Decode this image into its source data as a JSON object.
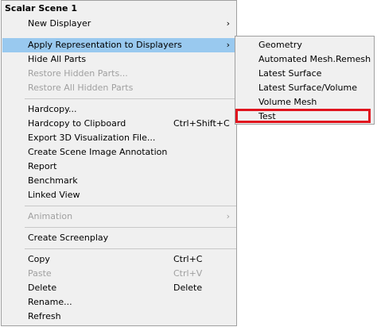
{
  "menu": {
    "title": "Scalar Scene 1",
    "items": [
      {
        "label": "New Displayer",
        "shortcut": "",
        "chevron": "›"
      },
      {
        "label": "Apply Representation to Displayers",
        "shortcut": "",
        "chevron": "›"
      },
      {
        "label": "Hide All Parts",
        "shortcut": "",
        "chevron": ""
      },
      {
        "label": "Restore Hidden Parts...",
        "shortcut": "",
        "chevron": ""
      },
      {
        "label": "Restore All Hidden Parts",
        "shortcut": "",
        "chevron": ""
      },
      {
        "label": "Hardcopy...",
        "shortcut": "",
        "chevron": ""
      },
      {
        "label": "Hardcopy to Clipboard",
        "shortcut": "Ctrl+Shift+C",
        "chevron": ""
      },
      {
        "label": "Export 3D Visualization File...",
        "shortcut": "",
        "chevron": ""
      },
      {
        "label": "Create Scene Image Annotation",
        "shortcut": "",
        "chevron": ""
      },
      {
        "label": "Report",
        "shortcut": "",
        "chevron": ""
      },
      {
        "label": "Benchmark",
        "shortcut": "",
        "chevron": ""
      },
      {
        "label": "Linked View",
        "shortcut": "",
        "chevron": ""
      },
      {
        "label": "Animation",
        "shortcut": "",
        "chevron": "›"
      },
      {
        "label": "Create Screenplay",
        "shortcut": "",
        "chevron": ""
      },
      {
        "label": "Copy",
        "shortcut": "Ctrl+C",
        "chevron": ""
      },
      {
        "label": "Paste",
        "shortcut": "Ctrl+V",
        "chevron": ""
      },
      {
        "label": "Delete",
        "shortcut": "Delete",
        "chevron": ""
      },
      {
        "label": "Rename...",
        "shortcut": "",
        "chevron": ""
      },
      {
        "label": "Refresh",
        "shortcut": "",
        "chevron": ""
      }
    ]
  },
  "submenu": {
    "items": [
      {
        "label": "Geometry"
      },
      {
        "label": "Automated Mesh.Remesh"
      },
      {
        "label": "Latest Surface"
      },
      {
        "label": "Latest Surface/Volume"
      },
      {
        "label": "Volume Mesh"
      },
      {
        "label": "Test"
      }
    ]
  },
  "colors": {
    "highlight": "#99c9ef",
    "annotation_box": "#e0141e",
    "disabled_text": "#a0a0a0"
  }
}
